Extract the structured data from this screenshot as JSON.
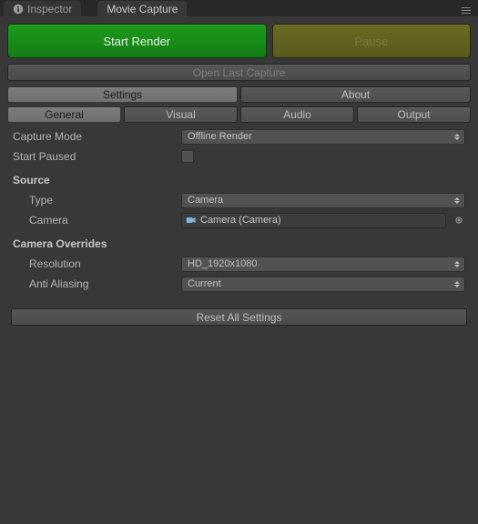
{
  "tabs": {
    "inspector": "Inspector",
    "movie_capture": "Movie Capture"
  },
  "actions": {
    "start_render": "Start Render",
    "pause": "Pause",
    "open_last": "Open Last Capture",
    "reset": "Reset All Settings"
  },
  "toggle_main": {
    "settings": "Settings",
    "about": "About"
  },
  "toggle_sub": {
    "general": "General",
    "visual": "Visual",
    "audio": "Audio",
    "output": "Output"
  },
  "labels": {
    "capture_mode": "Capture Mode",
    "start_paused": "Start Paused",
    "source": "Source",
    "type": "Type",
    "camera": "Camera",
    "overrides": "Camera Overrides",
    "resolution": "Resolution",
    "anti_aliasing": "Anti Aliasing"
  },
  "values": {
    "capture_mode": "Offline Render",
    "type": "Camera",
    "camera": "Camera (Camera)",
    "resolution": "HD_1920x1080",
    "anti_aliasing": "Current",
    "start_paused": false
  },
  "colors": {
    "start_render_bg": "#1e9c1e",
    "pause_bg": "#6a6a22",
    "panel_bg": "#383838"
  }
}
